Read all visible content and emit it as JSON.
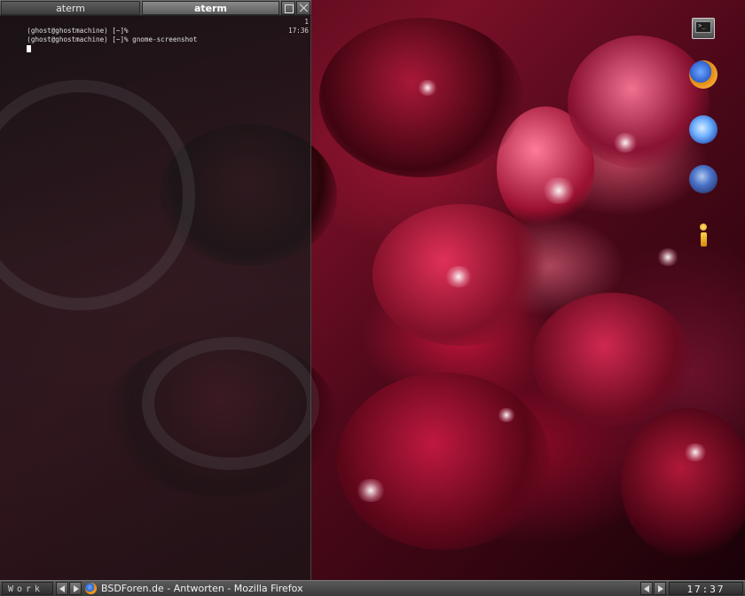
{
  "window": {
    "tabs": [
      {
        "label": "aterm",
        "active": false
      },
      {
        "label": "aterm",
        "active": true
      }
    ]
  },
  "terminal": {
    "lines": [
      {
        "text": "(ghost@ghostmachine) [~]%",
        "right": "1"
      },
      {
        "text": "(ghost@ghostmachine) [~]% gnome-screenshot",
        "right": "17:36"
      }
    ]
  },
  "dock": {
    "icons": [
      "terminal-icon",
      "firefox-icon",
      "thunderbird-icon",
      "blue-circle-icon",
      "info-icon"
    ]
  },
  "taskbar": {
    "workspace": "Work",
    "active_window": "BSDForen.de - Antworten - Mozilla Firefox",
    "clock": "17:37"
  },
  "colors": {
    "accent": "#7a1028",
    "taskbar": "#4a4a4a",
    "terminal_text": "#d8d8d8"
  }
}
